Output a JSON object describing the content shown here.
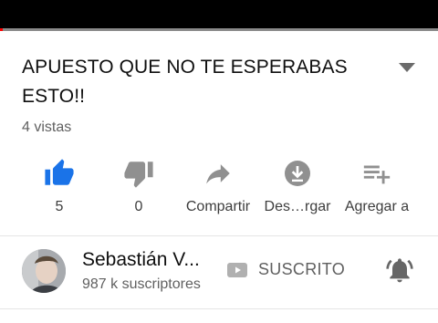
{
  "player": {
    "progress_fraction": 0.006,
    "played_color": "#ff0000"
  },
  "video": {
    "title": "APUESTO QUE NO TE ESPERABAS ESTO!!",
    "views": "4 vistas",
    "expand_icon": "chevron-down-icon"
  },
  "actions": {
    "like": {
      "count": "5",
      "icon": "thumb-up-icon",
      "active_color": "#1a73e8"
    },
    "dislike": {
      "count": "0",
      "icon": "thumb-down-icon"
    },
    "share": {
      "label": "Compartir",
      "icon": "share-icon"
    },
    "download": {
      "label": "Des…rgar",
      "icon": "download-icon"
    },
    "add": {
      "label": "Agregar a",
      "icon": "playlist-add-icon"
    }
  },
  "channel": {
    "name": "Sebastián V...",
    "subscribers": "987 k suscriptores",
    "subscribed_label": "SUSCRITO",
    "subscribed_icon": "youtube-icon",
    "bell_icon": "bell-icon"
  }
}
